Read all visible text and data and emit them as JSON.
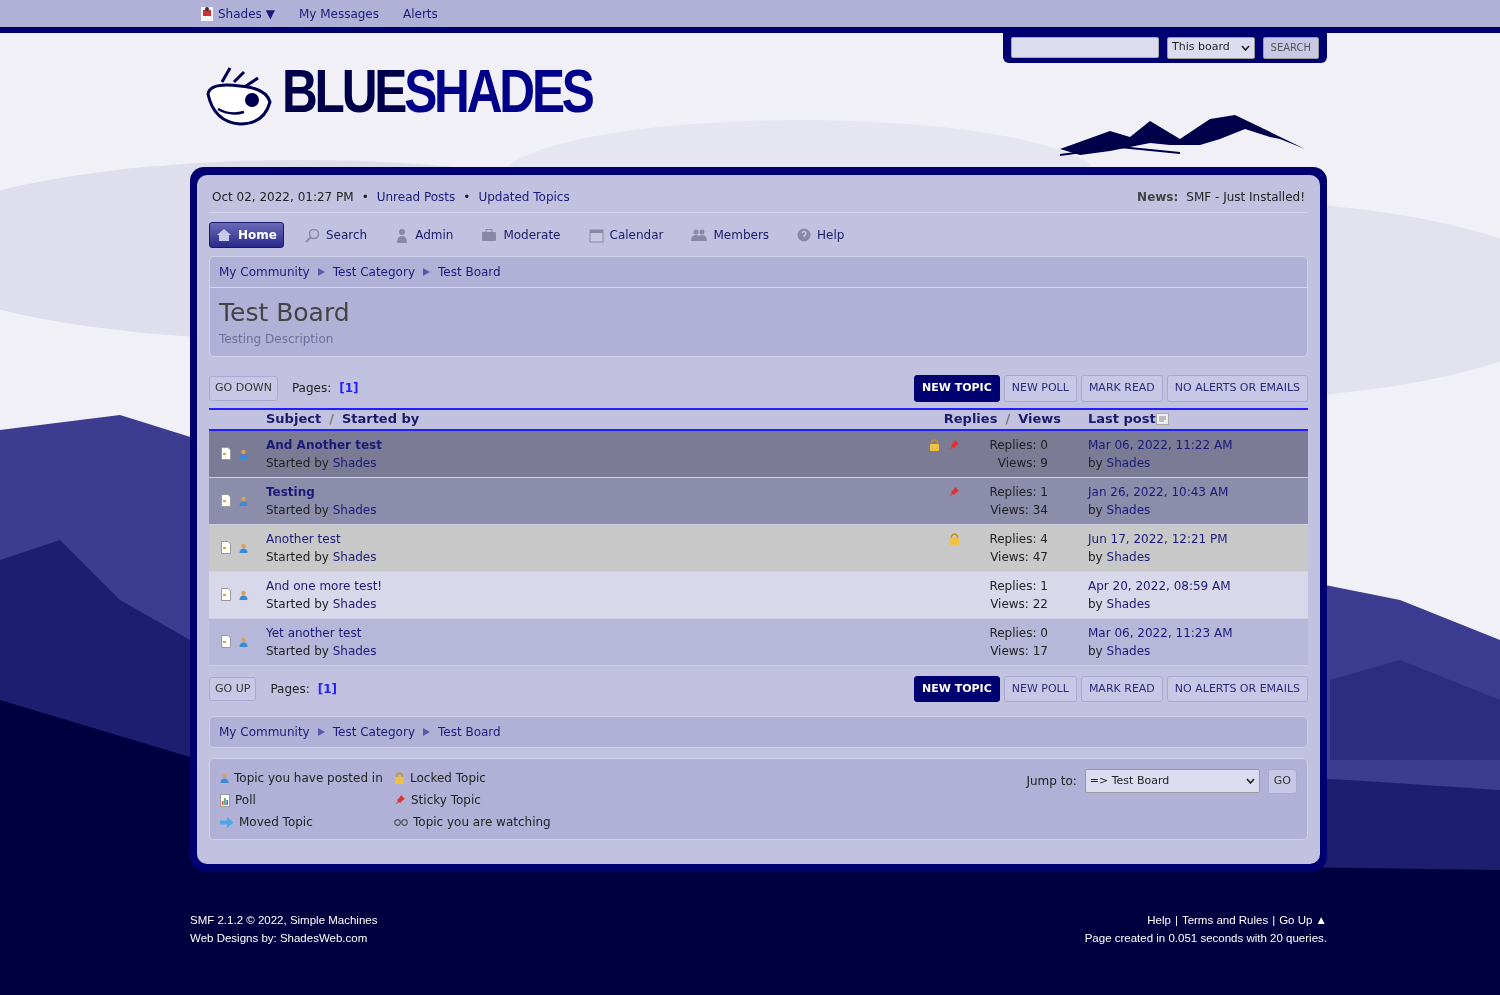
{
  "top_bar": {
    "user": "Shades ▼",
    "links": [
      "My Messages",
      "Alerts"
    ]
  },
  "search": {
    "scope": "This board",
    "button": "SEARCH"
  },
  "logo": {
    "part_1": "BLUE",
    "part_2": "SHADES"
  },
  "info_bar": {
    "date": "Oct 02, 2022, 01:27 PM",
    "links": [
      "Unread Posts",
      "Updated Topics"
    ],
    "bullets": [
      "•",
      "•"
    ],
    "news_label": "News:",
    "news": "SMF - Just Installed!"
  },
  "menu": [
    {
      "label": "Home",
      "selected": true
    },
    {
      "label": "Search",
      "selected": false
    },
    {
      "label": "Admin",
      "selected": false
    },
    {
      "label": "Moderate",
      "selected": false
    },
    {
      "label": "Calendar",
      "selected": false
    },
    {
      "label": "Members",
      "selected": false
    },
    {
      "label": "Help",
      "selected": false
    }
  ],
  "breadcrumbs": [
    "My Community",
    "Test Category",
    "Test Board"
  ],
  "breadcrumbs_bottom": [
    "My Community",
    "Test Category",
    "Test Board"
  ],
  "board": {
    "title": "Test Board",
    "description": "Testing Description"
  },
  "pager_top": {
    "button": "GO DOWN",
    "label": "Pages:",
    "page": "[1]"
  },
  "pager_bottom": {
    "button": "GO UP",
    "label": "Pages:",
    "page": "[1]"
  },
  "actions": [
    "NEW TOPIC",
    "NEW POLL",
    "MARK READ",
    "NO ALERTS OR EMAILS"
  ],
  "actions_bottom": [
    "NEW TOPIC",
    "NEW POLL",
    "MARK READ",
    "NO ALERTS OR EMAILS"
  ],
  "table": {
    "columns": [
      "Subject",
      "/",
      "Started by",
      "Replies",
      "/",
      "Views",
      "Last post"
    ],
    "rows": [
      {
        "subject": "And Another test",
        "started_prefix": "Started by",
        "starter": "Shades",
        "sticky": true,
        "locked": true,
        "alternate": false,
        "replies": "Replies: 0",
        "views": "Views: 9",
        "last_date": "Mar 06, 2022, 11:22 AM",
        "last_prefix": "by",
        "last_by": "Shades"
      },
      {
        "subject": "Testing",
        "started_prefix": "Started by",
        "starter": "Shades",
        "sticky": true,
        "locked": false,
        "alternate": false,
        "replies": "Replies: 1",
        "views": "Views: 34",
        "last_date": "Jan 26, 2022, 10:43 AM",
        "last_prefix": "by",
        "last_by": "Shades"
      },
      {
        "subject": "Another test",
        "started_prefix": "Started by",
        "starter": "Shades",
        "sticky": false,
        "locked": true,
        "alternate": false,
        "replies": "Replies: 4",
        "views": "Views: 47",
        "last_date": "Jun 17, 2022, 12:21 PM",
        "last_prefix": "by",
        "last_by": "Shades"
      },
      {
        "subject": "And one more test!",
        "started_prefix": "Started by",
        "starter": "Shades",
        "sticky": false,
        "locked": false,
        "alternate": true,
        "replies": "Replies: 1",
        "views": "Views: 22",
        "last_date": "Apr 20, 2022, 08:59 AM",
        "last_prefix": "by",
        "last_by": "Shades"
      },
      {
        "subject": "Yet another test",
        "started_prefix": "Started by",
        "starter": "Shades",
        "sticky": false,
        "locked": false,
        "alternate": false,
        "replies": "Replies: 0",
        "views": "Views: 17",
        "last_date": "Mar 06, 2022, 11:23 AM",
        "last_prefix": "by",
        "last_by": "Shades"
      }
    ]
  },
  "legend": [
    "Topic you have posted in",
    "Poll",
    "Moved Topic",
    "Locked Topic",
    "Sticky Topic",
    "Topic you are watching"
  ],
  "jump": {
    "label": "Jump to:",
    "value": "=> Test Board",
    "button": "GO"
  },
  "footer": {
    "left": [
      "SMF 2.1.2 © 2022, Simple Machines",
      "Web Designs by: ShadesWeb.com"
    ],
    "links": [
      "Help",
      "Terms and Rules",
      "Go Up ▲"
    ],
    "separators": [
      "|",
      "|"
    ],
    "stats": "Page created in 0.051 seconds with 20 queries."
  }
}
